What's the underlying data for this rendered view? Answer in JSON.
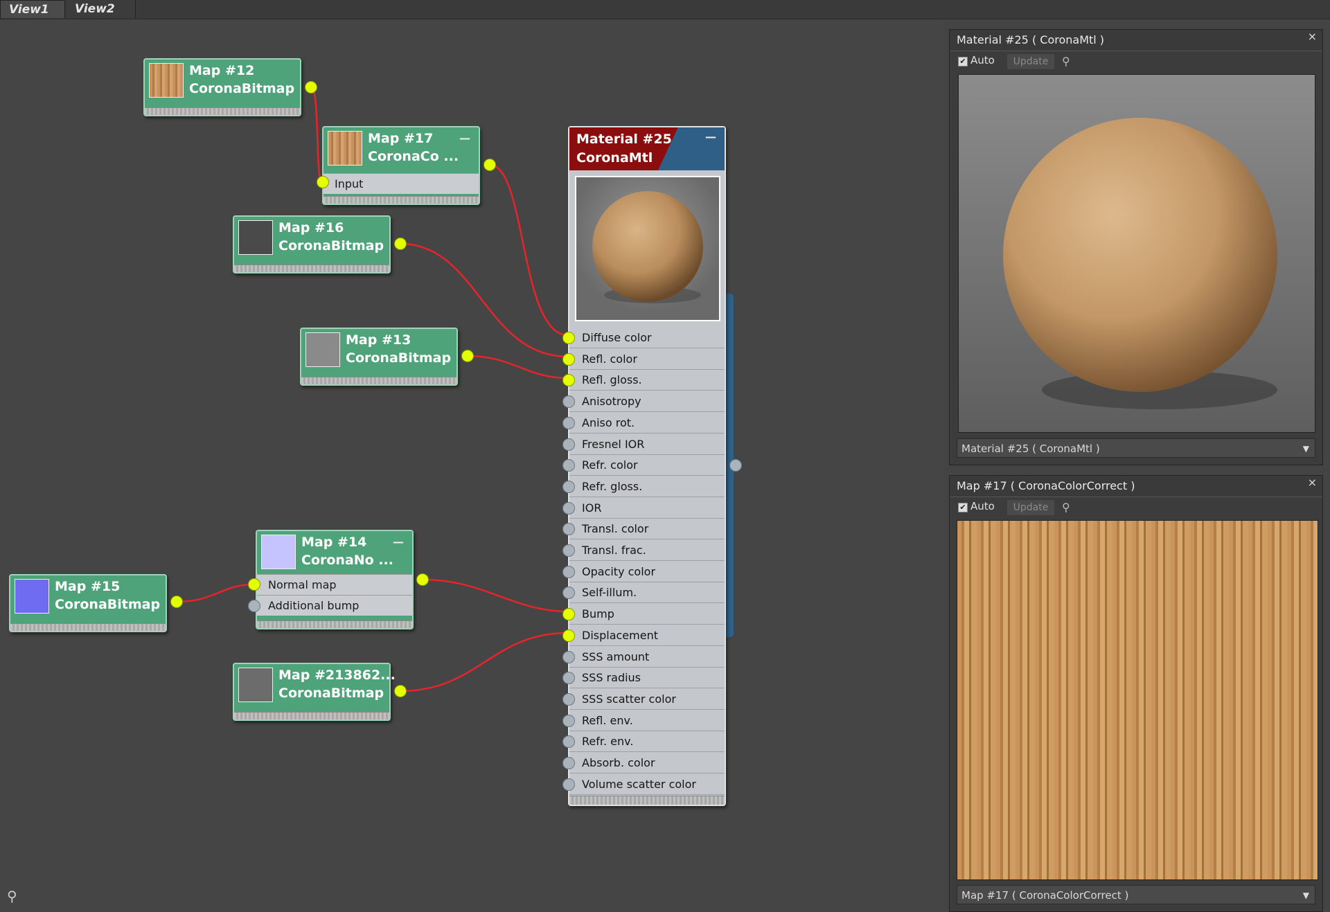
{
  "tabs": [
    "View1",
    "View2"
  ],
  "nodes": {
    "map12": {
      "title": "Map #12",
      "type": "CoronaBitmap"
    },
    "map17": {
      "title": "Map #17",
      "type": "CoronaCo ...",
      "slot": "Input"
    },
    "map16": {
      "title": "Map #16",
      "type": "CoronaBitmap"
    },
    "map13": {
      "title": "Map #13",
      "type": "CoronaBitmap"
    },
    "map14": {
      "title": "Map #14",
      "type": "CoronaNo ...",
      "slots": [
        "Normal map",
        "Additional bump"
      ]
    },
    "map15": {
      "title": "Map #15",
      "type": "CoronaBitmap"
    },
    "map213862": {
      "title": "Map #213862...",
      "type": "CoronaBitmap"
    }
  },
  "material": {
    "title": "Material #25",
    "type": "CoronaMtl",
    "slots": [
      {
        "label": "Diffuse color",
        "connected": true
      },
      {
        "label": "Refl. color",
        "connected": true
      },
      {
        "label": "Refl. gloss.",
        "connected": true
      },
      {
        "label": "Anisotropy",
        "connected": false
      },
      {
        "label": "Aniso rot.",
        "connected": false
      },
      {
        "label": "Fresnel IOR",
        "connected": false
      },
      {
        "label": "Refr. color",
        "connected": false
      },
      {
        "label": "Refr. gloss.",
        "connected": false
      },
      {
        "label": "IOR",
        "connected": false
      },
      {
        "label": "Transl. color",
        "connected": false
      },
      {
        "label": "Transl. frac.",
        "connected": false
      },
      {
        "label": "Opacity color",
        "connected": false
      },
      {
        "label": "Self-illum.",
        "connected": false
      },
      {
        "label": "Bump",
        "connected": true
      },
      {
        "label": "Displacement",
        "connected": true
      },
      {
        "label": "SSS amount",
        "connected": false
      },
      {
        "label": "SSS radius",
        "connected": false
      },
      {
        "label": "SSS scatter color",
        "connected": false
      },
      {
        "label": "Refl. env.",
        "connected": false
      },
      {
        "label": "Refr. env.",
        "connected": false
      },
      {
        "label": "Absorb. color",
        "connected": false
      },
      {
        "label": "Volume scatter color",
        "connected": false
      }
    ]
  },
  "panel1": {
    "title": "Material #25  ( CoronaMtl )",
    "close": "×",
    "auto_label": "Auto",
    "update_label": "Update",
    "dropdown": "Material #25  ( CoronaMtl )"
  },
  "panel2": {
    "title": "Map #17  ( CoronaColorCorrect )",
    "close": "×",
    "auto_label": "Auto",
    "update_label": "Update",
    "dropdown": "Map #17  ( CoronaColorCorrect )"
  },
  "colors": {
    "node_green": "#4fa37a",
    "wire": "#e8242b",
    "socket_active": "#e4ff00",
    "material_header_red": "#8b0d0d",
    "material_header_blue": "#2f5f86"
  },
  "icons": {
    "check": "✔",
    "dropdown": "▼",
    "minimize": "—",
    "binoculars": "⚲"
  }
}
